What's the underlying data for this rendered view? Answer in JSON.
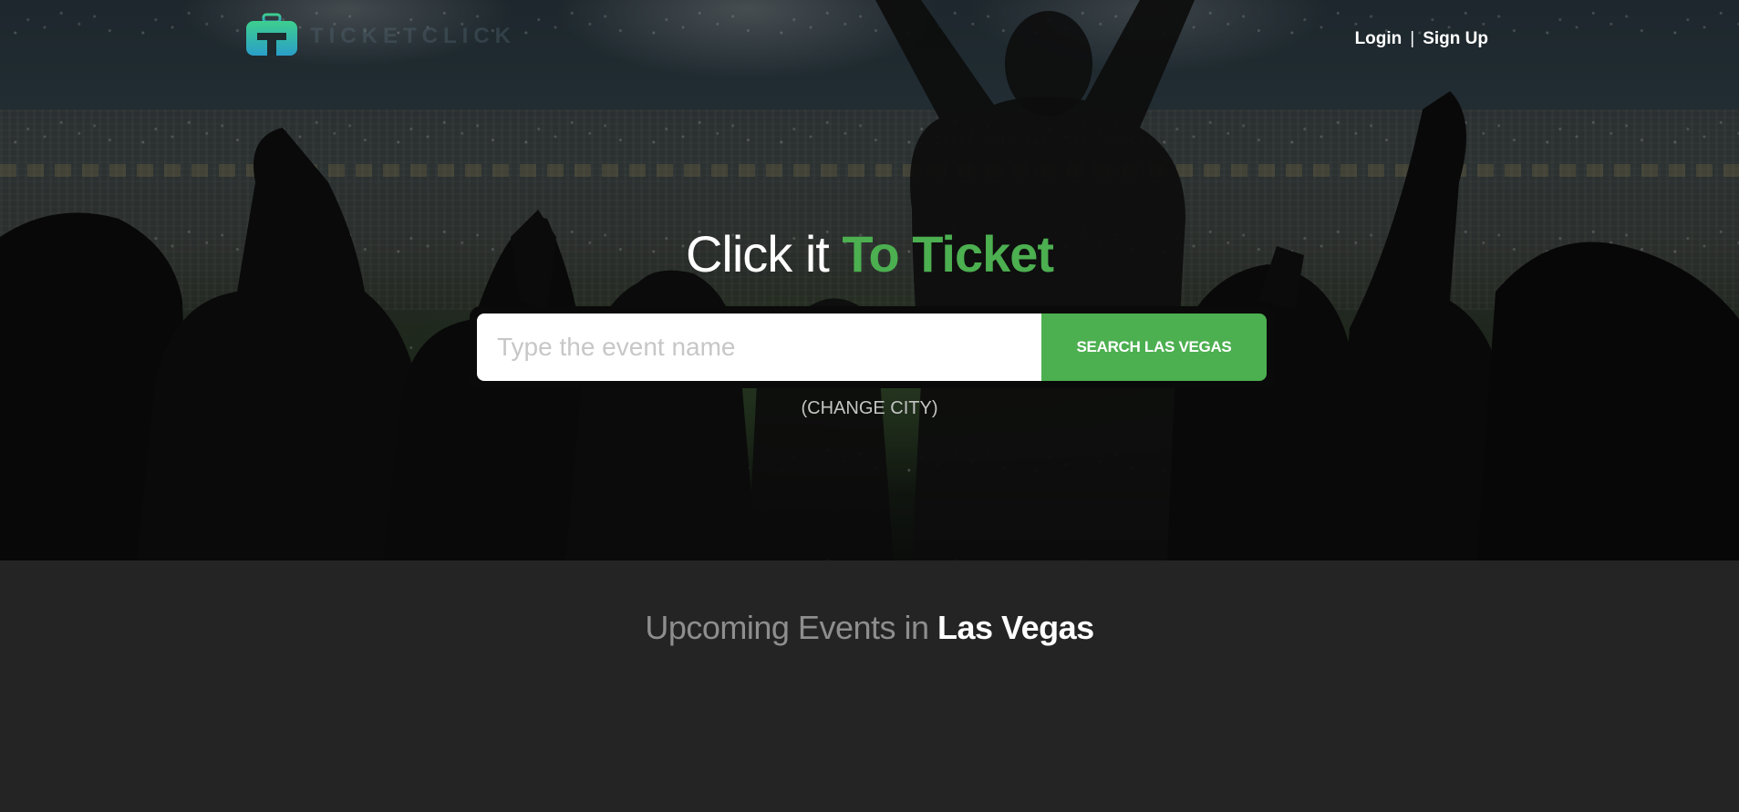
{
  "header": {
    "logo_text": "TICKETCLICK",
    "login_label": "Login",
    "separator": "|",
    "signup_label": "Sign Up"
  },
  "hero": {
    "headline_prefix": "Click it ",
    "headline_accent": "To Ticket",
    "search": {
      "placeholder": "Type the event name",
      "value": "",
      "button_label": "SEARCH LAS VEGAS"
    },
    "change_city_label": "(CHANGE CITY)"
  },
  "upcoming": {
    "prefix": "Upcoming Events in ",
    "city": "Las Vegas"
  },
  "colors": {
    "accent": "#4caf50",
    "page_background": "#242424",
    "text_white": "#ffffff",
    "muted_text": "#8e8e8e"
  },
  "icons": {
    "logo": "ticket-bag-logo-icon"
  }
}
